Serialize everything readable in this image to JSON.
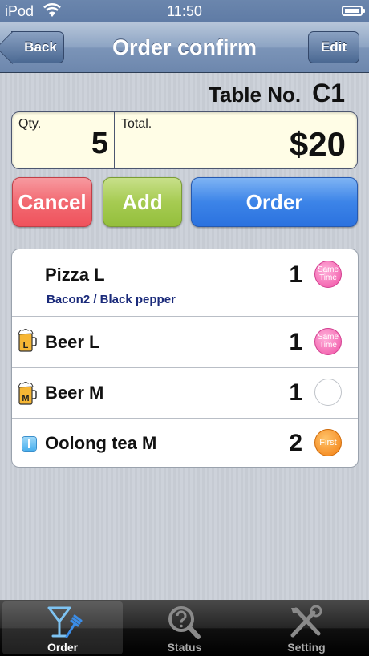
{
  "status_bar": {
    "carrier": "iPod",
    "time": "11:50"
  },
  "nav": {
    "title": "Order confirm",
    "back_label": "Back",
    "edit_label": "Edit"
  },
  "table": {
    "label": "Table No.",
    "value": "C1"
  },
  "summary": {
    "qty_label": "Qty.",
    "qty_value": "5",
    "total_label": "Total.",
    "total_value": "$20"
  },
  "actions": {
    "cancel": "Cancel",
    "add": "Add",
    "order": "Order"
  },
  "items": [
    {
      "name": "Pizza L",
      "options": "Bacon2 / Black pepper",
      "qty": "1",
      "badge": "Same Time",
      "badge_color": "#f04fa4",
      "icon": "none"
    },
    {
      "name": "Beer L",
      "options": "",
      "qty": "1",
      "badge": "Same Time",
      "badge_color": "#f04fa4",
      "icon": "beer-mug-L-icon",
      "icon_letter": "L"
    },
    {
      "name": "Beer M",
      "options": "",
      "qty": "1",
      "badge": "",
      "badge_color": "#ffffff",
      "icon": "beer-mug-M-icon",
      "icon_letter": "M"
    },
    {
      "name": "Oolong tea M",
      "options": "",
      "qty": "2",
      "badge": "First",
      "badge_color": "#f27d10",
      "icon": "tea-icon"
    }
  ],
  "tabs": [
    {
      "label": "Order",
      "icon": "cocktail-fork-icon",
      "selected": true
    },
    {
      "label": "Status",
      "icon": "magnifier-question-icon",
      "selected": false
    },
    {
      "label": "Setting",
      "icon": "tools-icon",
      "selected": false
    }
  ]
}
